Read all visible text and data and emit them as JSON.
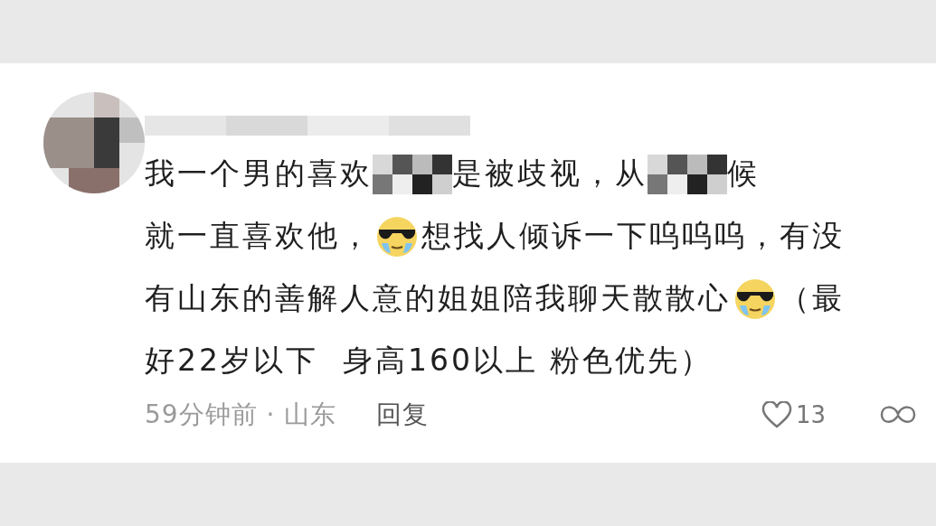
{
  "comment": {
    "lines": [
      [
        {
          "kind": "text",
          "text": "我一个男的喜欢"
        },
        {
          "kind": "mosaic"
        },
        {
          "kind": "text",
          "text": "是被歧视，从"
        },
        {
          "kind": "mosaic"
        },
        {
          "kind": "text",
          "text": "候"
        }
      ],
      [
        {
          "kind": "text",
          "text": "就一直喜欢他，"
        },
        {
          "kind": "emoji"
        },
        {
          "kind": "text",
          "text": "想找人倾诉一下呜呜呜，有没"
        }
      ],
      [
        {
          "kind": "text",
          "text": "有山东的善解人意的姐姐陪我聊天散散心"
        },
        {
          "kind": "emoji"
        },
        {
          "kind": "text",
          "text": "（最"
        }
      ],
      [
        {
          "kind": "text",
          "text": "好22岁以下  身高160以上 粉色优先）"
        }
      ]
    ],
    "meta": "59分钟前 · 山东",
    "reply": "回复",
    "likes": "13"
  }
}
